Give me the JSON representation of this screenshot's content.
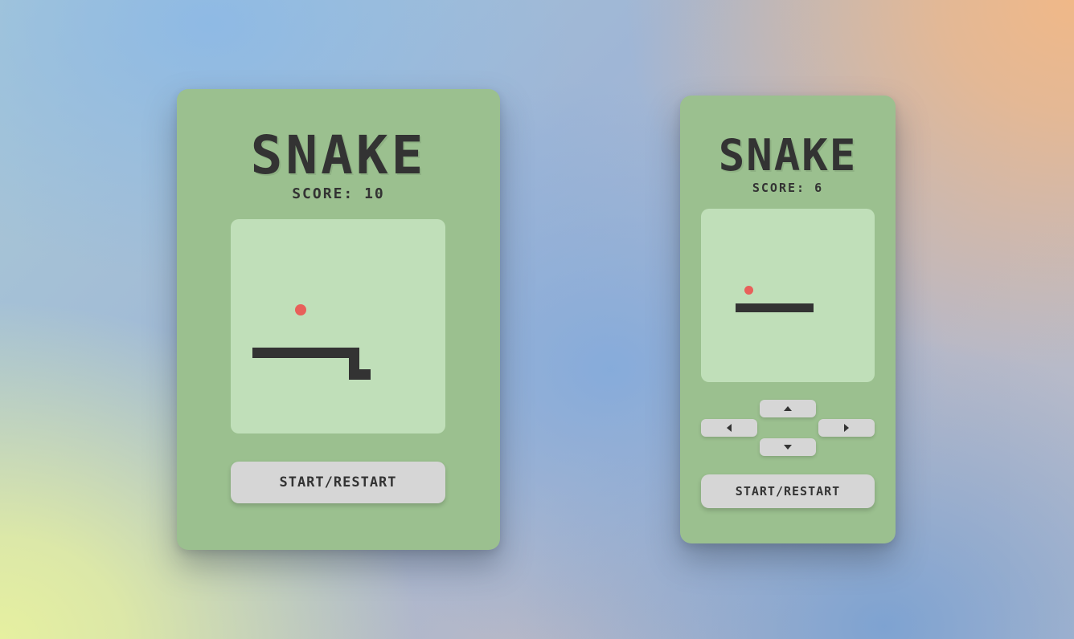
{
  "colors": {
    "card": "#9bc08f",
    "board": "#c0dfb9",
    "snake": "#333333",
    "food": "#e8605a",
    "button": "#d6d6d6",
    "text": "#333333"
  },
  "desktop_game": {
    "title": "SNAKE",
    "score_text": "SCORE: 10",
    "start_label": "START/RESTART"
  },
  "mobile_game": {
    "title": "SNAKE",
    "score_text": "SCORE: 6",
    "start_label": "START/RESTART",
    "dpad": {
      "up_icon": "arrow-up-icon",
      "down_icon": "arrow-down-icon",
      "left_icon": "arrow-left-icon",
      "right_icon": "arrow-right-icon"
    }
  }
}
